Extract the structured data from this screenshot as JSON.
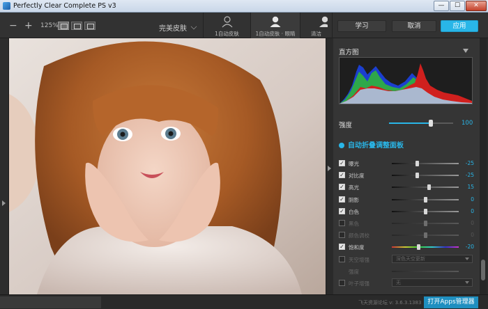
{
  "window": {
    "title": "Perfectly Clear Complete PS v3",
    "min": "—",
    "max": "☐",
    "close": "✕"
  },
  "toolbar": {
    "zoom_out": "−",
    "zoom_in": "+",
    "zoom_level": "125%",
    "preset": "完美皮肤",
    "skin_buttons": [
      {
        "label": "1自动皮肤",
        "icon": "person-auto-icon"
      },
      {
        "label": "1自动皮肤 · 眼睛",
        "icon": "person-icon"
      },
      {
        "label": "清洁",
        "icon": "person-partial-icon"
      }
    ],
    "learn": "学习",
    "cancel": "取消",
    "apply": "应用"
  },
  "panel": {
    "histogram_title": "直方图",
    "strength_label": "强度",
    "strength_value": "100",
    "strength_fraction": 0.65,
    "section_title": "自动折叠调整面板",
    "adjustments": [
      {
        "name": "曝光",
        "checked": true,
        "value": "-25",
        "fraction": 0.38,
        "enabled": true
      },
      {
        "name": "对比度",
        "checked": true,
        "value": "-25",
        "fraction": 0.38,
        "enabled": true
      },
      {
        "name": "高光",
        "checked": true,
        "value": "15",
        "fraction": 0.55,
        "enabled": true
      },
      {
        "name": "阴影",
        "checked": true,
        "value": "0",
        "fraction": 0.5,
        "enabled": true
      },
      {
        "name": "白色",
        "checked": true,
        "value": "0",
        "fraction": 0.5,
        "enabled": true
      },
      {
        "name": "黑色",
        "checked": false,
        "value": "0",
        "fraction": 0.5,
        "enabled": false
      },
      {
        "name": "颜色调校",
        "checked": false,
        "value": "0",
        "fraction": 0.5,
        "enabled": false
      },
      {
        "name": "饱和度",
        "checked": true,
        "value": "-20",
        "fraction": 0.4,
        "enabled": true
      }
    ],
    "select_rows": [
      {
        "name": "天空增强",
        "select": "深色天空更新"
      },
      {
        "name": "强度",
        "select": ""
      },
      {
        "name": "叶子增强",
        "select": "无"
      }
    ]
  },
  "status": {
    "version": "飞天资源论坛  v: 3.6.3.1383",
    "open_apps": "打开Apps管理器"
  },
  "colors": {
    "accent": "#29b6e8",
    "panel_bg": "#353535",
    "toolbar_bg": "#323232"
  }
}
